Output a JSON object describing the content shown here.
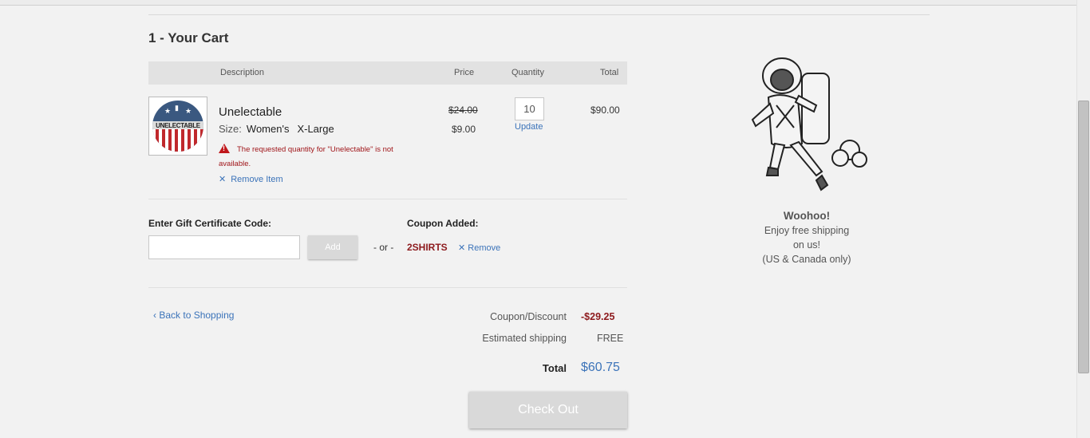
{
  "page": {
    "title": "1 - Your Cart"
  },
  "table": {
    "headers": {
      "description": "Description",
      "price": "Price",
      "quantity": "Quantity",
      "total": "Total"
    }
  },
  "item": {
    "name": "Unelectable",
    "size_label": "Size:",
    "size_gender": "Women's",
    "size_value": "X-Large",
    "thumb_text": "UNELECTABLE",
    "warning": "The requested quantity for \"Unelectable\" is not available.",
    "remove_label": "Remove Item",
    "price_old": "$24.00",
    "price_new": "$9.00",
    "quantity": "10",
    "update_label": "Update",
    "total": "$90.00"
  },
  "gift": {
    "label": "Enter Gift Certificate Code:",
    "placeholder": "",
    "add_label": "Add"
  },
  "or_text": "- or -",
  "coupon": {
    "label": "Coupon Added:",
    "code": "2SHIRTS",
    "remove_label": "Remove"
  },
  "back_label": "Back to Shopping",
  "summary": {
    "discount_label": "Coupon/Discount",
    "discount_value": "-$29.25",
    "shipping_label": "Estimated shipping",
    "shipping_value": "FREE",
    "total_label": "Total",
    "total_value": "$60.75"
  },
  "checkout_label": "Check Out",
  "promo": {
    "headline": "Woohoo!",
    "line1": "Enjoy free shipping",
    "line2": "on us!",
    "line3": "(US & Canada only)"
  },
  "colors": {
    "link": "#3b73b9",
    "error": "#c0171b",
    "coupon": "#8d1a1d",
    "button": "#d9d9d9"
  },
  "icons": {
    "warning": "warning-triangle-icon",
    "remove": "close-icon",
    "back": "chevron-left-icon"
  }
}
